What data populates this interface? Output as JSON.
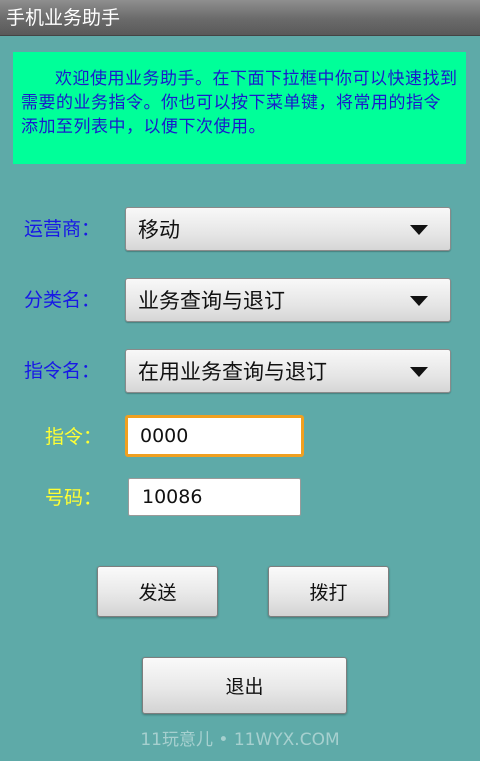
{
  "window": {
    "title": "手机业务助手"
  },
  "intro": {
    "text": "欢迎使用业务助手。在下面下拉框中你可以快速找到需要的业务指令。你也可以按下菜单键，将常用的指令添加至列表中，以便下次使用。"
  },
  "form": {
    "carrier": {
      "label": "运营商：",
      "value": "移动"
    },
    "category": {
      "label": "分类名：",
      "value": "业务查询与退订"
    },
    "command_name": {
      "label": "指令名：",
      "value": "在用业务查询与退订"
    },
    "command": {
      "label": "指令：",
      "value": "0000"
    },
    "number": {
      "label": "号码：",
      "value": "10086"
    }
  },
  "buttons": {
    "send": "发送",
    "dial": "拨打",
    "exit": "退出"
  },
  "watermark": {
    "text": "11玩意儿 • 11WYX.COM"
  },
  "colors": {
    "background": "#5eaaa8",
    "intro_background": "#00ff99",
    "intro_text": "#1a1acc",
    "spinner_label": "#1818e6",
    "field_label": "#ffff33",
    "focus_border": "#f0a020"
  }
}
